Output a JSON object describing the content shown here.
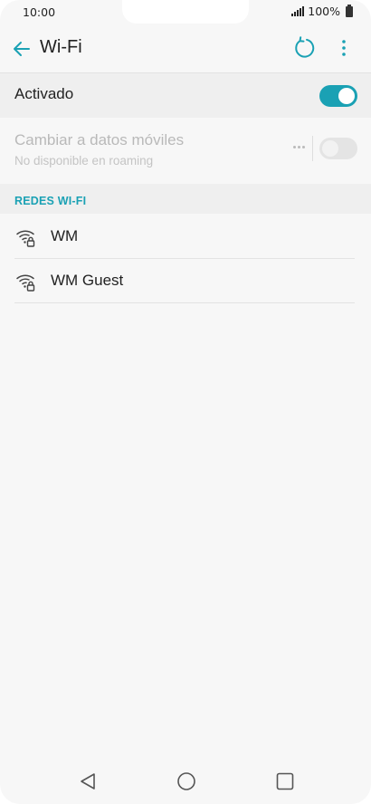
{
  "status_bar": {
    "time": "10:00",
    "battery": "100%"
  },
  "header": {
    "title": "Wi-Fi",
    "back_icon": "arrow-left-icon",
    "refresh_icon": "refresh-icon",
    "more_icon": "more-vertical-icon"
  },
  "wifi_toggle": {
    "label": "Activado",
    "state": "on"
  },
  "mobile_data": {
    "title": "Cambiar a datos móviles",
    "subtitle": "No disponible en roaming",
    "state": "disabled"
  },
  "networks_section": {
    "title": "REDES WI-FI",
    "items": [
      {
        "name": "WM",
        "icon": "wifi-lock-icon"
      },
      {
        "name": "WM Guest",
        "icon": "wifi-lock-icon"
      }
    ]
  },
  "colors": {
    "accent": "#1aa1b4",
    "background": "#f7f7f7",
    "section_bg": "#efefef"
  },
  "nav": {
    "back_icon": "triangle-back-icon",
    "home_icon": "circle-home-icon",
    "recents_icon": "square-recents-icon"
  }
}
